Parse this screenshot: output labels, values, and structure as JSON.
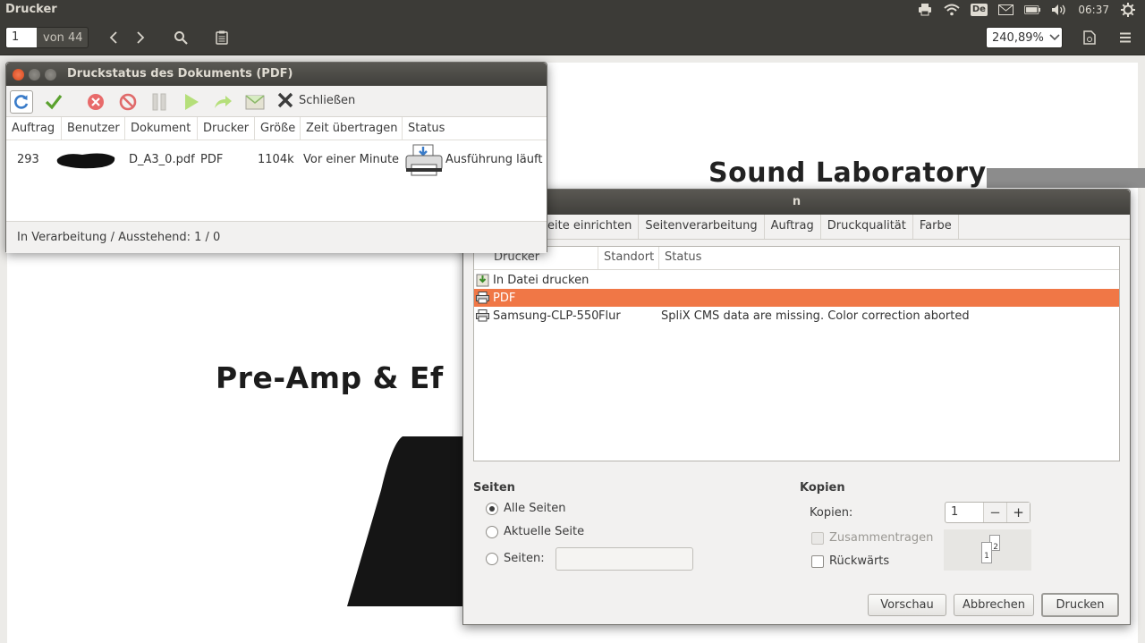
{
  "top_panel": {
    "app_title": "Drucker",
    "keyboard_layout": "De",
    "clock": "06:37",
    "icons": [
      "printer-icon",
      "wifi-icon",
      "keyboard-layout-icon",
      "mail-icon",
      "battery-icon",
      "volume-icon",
      "settings-gear-icon"
    ]
  },
  "viewer_toolbar": {
    "page_number": "1",
    "page_of": "von 44",
    "zoom": "240,89%"
  },
  "document": {
    "title": "Sound Laboratory",
    "heading": "Pre-Amp & Ef"
  },
  "print_dialog": {
    "title": "n",
    "tabs": [
      "eite einrichten",
      "Seitenverarbeitung",
      "Auftrag",
      "Druckqualität",
      "Farbe"
    ],
    "columns": [
      "Drucker",
      "Standort",
      "Status"
    ],
    "printers": [
      {
        "name": "In Datei drucken",
        "location": "",
        "status": "",
        "selected": false,
        "icon": "file-print-icon"
      },
      {
        "name": "PDF",
        "location": "",
        "status": "",
        "selected": true,
        "icon": "printer-icon"
      },
      {
        "name": "Samsung-CLP-550",
        "location": "Flur",
        "status": "SpliX CMS data are missing. Color correction aborted",
        "selected": false,
        "icon": "printer-icon"
      }
    ],
    "pages": {
      "heading": "Seiten",
      "all": "Alle Seiten",
      "current": "Aktuelle Seite",
      "range": "Seiten:",
      "selected": "all"
    },
    "copies": {
      "heading": "Kopien",
      "label": "Kopien:",
      "value": "1",
      "minus": "−",
      "plus": "+",
      "collate": "Zusammentragen",
      "reverse": "Rückwärts",
      "preview_pages": [
        "1",
        "2"
      ]
    },
    "buttons": {
      "preview": "Vorschau",
      "cancel": "Abbrechen",
      "print": "Drucken"
    }
  },
  "job_window": {
    "title": "Druckstatus des Dokuments (PDF)",
    "toolbar": {
      "close_label": "Schließen"
    },
    "columns": [
      "Auftrag",
      "Benutzer",
      "Dokument",
      "Drucker",
      "Größe",
      "Zeit übertragen",
      "Status"
    ],
    "job": {
      "id": "293",
      "user": "",
      "document": "D_A3_0.pdf",
      "printer": "PDF",
      "size": "1104k",
      "time": "Vor einer Minute",
      "status": "Ausführung läuft"
    },
    "status_bar": "In Verarbeitung / Ausstehend: 1 / 0"
  }
}
